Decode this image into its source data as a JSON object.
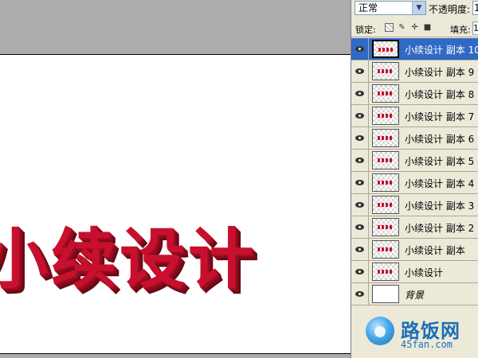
{
  "canvas": {
    "art_text": "小续设计"
  },
  "panel": {
    "blend_mode": "正常",
    "opacity_label": "不透明度:",
    "opacity_value": "1",
    "lock_label": "锁定:",
    "fill_label": "填充:",
    "fill_value": "1",
    "layers": [
      {
        "name": "小续设计 副本 10",
        "selected": true
      },
      {
        "name": "小续设计 副本 9"
      },
      {
        "name": "小续设计 副本 8"
      },
      {
        "name": "小续设计 副本 7"
      },
      {
        "name": "小续设计 副本 6"
      },
      {
        "name": "小续设计 副本 5"
      },
      {
        "name": "小续设计 副本 4"
      },
      {
        "name": "小续设计 副本 3"
      },
      {
        "name": "小续设计 副本 2"
      },
      {
        "name": "小续设计 副本"
      },
      {
        "name": "小续设计"
      },
      {
        "name": "背景",
        "background": true
      }
    ]
  },
  "watermark": {
    "name": "路饭网",
    "url": "45fan.com"
  },
  "colors": {
    "text_red": "#c8102e",
    "selection": "#316ac5"
  },
  "icons": {
    "visibility": "eye-icon",
    "lock_transparent": "lock-transparent-icon",
    "lock_image": "brush-icon",
    "lock_position": "move-icon",
    "lock_all": "lock-icon"
  }
}
